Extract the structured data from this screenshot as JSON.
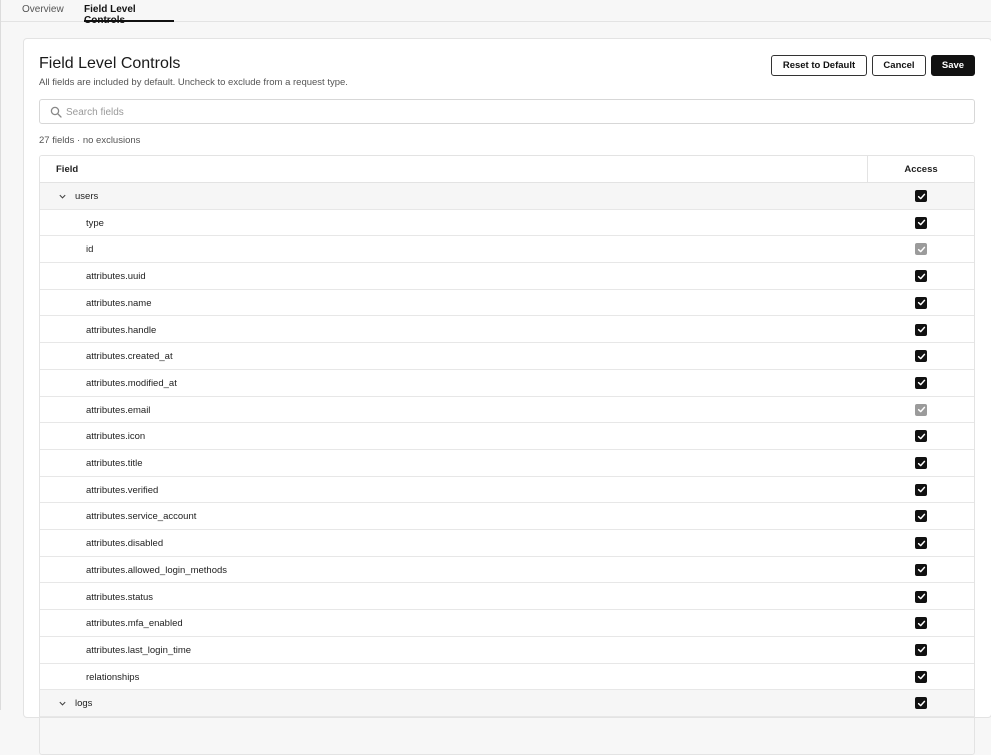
{
  "tabs": [
    {
      "label": "Overview",
      "active": false
    },
    {
      "label": "Field Level Controls",
      "active": true
    }
  ],
  "header": {
    "title": "Field Level Controls",
    "subtitle": "All fields are included by default. Uncheck to exclude from a request type.",
    "reset_label": "Reset to Default",
    "cancel_label": "Cancel",
    "save_label": "Save"
  },
  "search": {
    "icon": "search-icon",
    "placeholder": "Search fields",
    "value": ""
  },
  "summary": "27 fields · no exclusions",
  "table": {
    "columns": [
      "Field",
      "Access"
    ],
    "rows": [
      {
        "label": "users",
        "kind": "group",
        "checked": true,
        "disabled": false
      },
      {
        "label": "type",
        "kind": "child",
        "checked": true,
        "disabled": false
      },
      {
        "label": "id",
        "kind": "child",
        "checked": true,
        "disabled": true
      },
      {
        "label": "attributes.uuid",
        "kind": "child",
        "checked": true,
        "disabled": false
      },
      {
        "label": "attributes.name",
        "kind": "child",
        "checked": true,
        "disabled": false
      },
      {
        "label": "attributes.handle",
        "kind": "child",
        "checked": true,
        "disabled": false
      },
      {
        "label": "attributes.created_at",
        "kind": "child",
        "checked": true,
        "disabled": false
      },
      {
        "label": "attributes.modified_at",
        "kind": "child",
        "checked": true,
        "disabled": false
      },
      {
        "label": "attributes.email",
        "kind": "child",
        "checked": true,
        "disabled": true
      },
      {
        "label": "attributes.icon",
        "kind": "child",
        "checked": true,
        "disabled": false
      },
      {
        "label": "attributes.title",
        "kind": "child",
        "checked": true,
        "disabled": false
      },
      {
        "label": "attributes.verified",
        "kind": "child",
        "checked": true,
        "disabled": false
      },
      {
        "label": "attributes.service_account",
        "kind": "child",
        "checked": true,
        "disabled": false
      },
      {
        "label": "attributes.disabled",
        "kind": "child",
        "checked": true,
        "disabled": false
      },
      {
        "label": "attributes.allowed_login_methods",
        "kind": "child",
        "checked": true,
        "disabled": false
      },
      {
        "label": "attributes.status",
        "kind": "child",
        "checked": true,
        "disabled": false
      },
      {
        "label": "attributes.mfa_enabled",
        "kind": "child",
        "checked": true,
        "disabled": false
      },
      {
        "label": "attributes.last_login_time",
        "kind": "child",
        "checked": true,
        "disabled": false
      },
      {
        "label": "relationships",
        "kind": "child",
        "checked": true,
        "disabled": false
      },
      {
        "label": "logs",
        "kind": "group",
        "checked": true,
        "disabled": false
      }
    ]
  },
  "colors": {
    "accent": "#111111",
    "disabled_checkbox": "#9b9b9b",
    "group_row_bg": "#f6f6f6"
  }
}
